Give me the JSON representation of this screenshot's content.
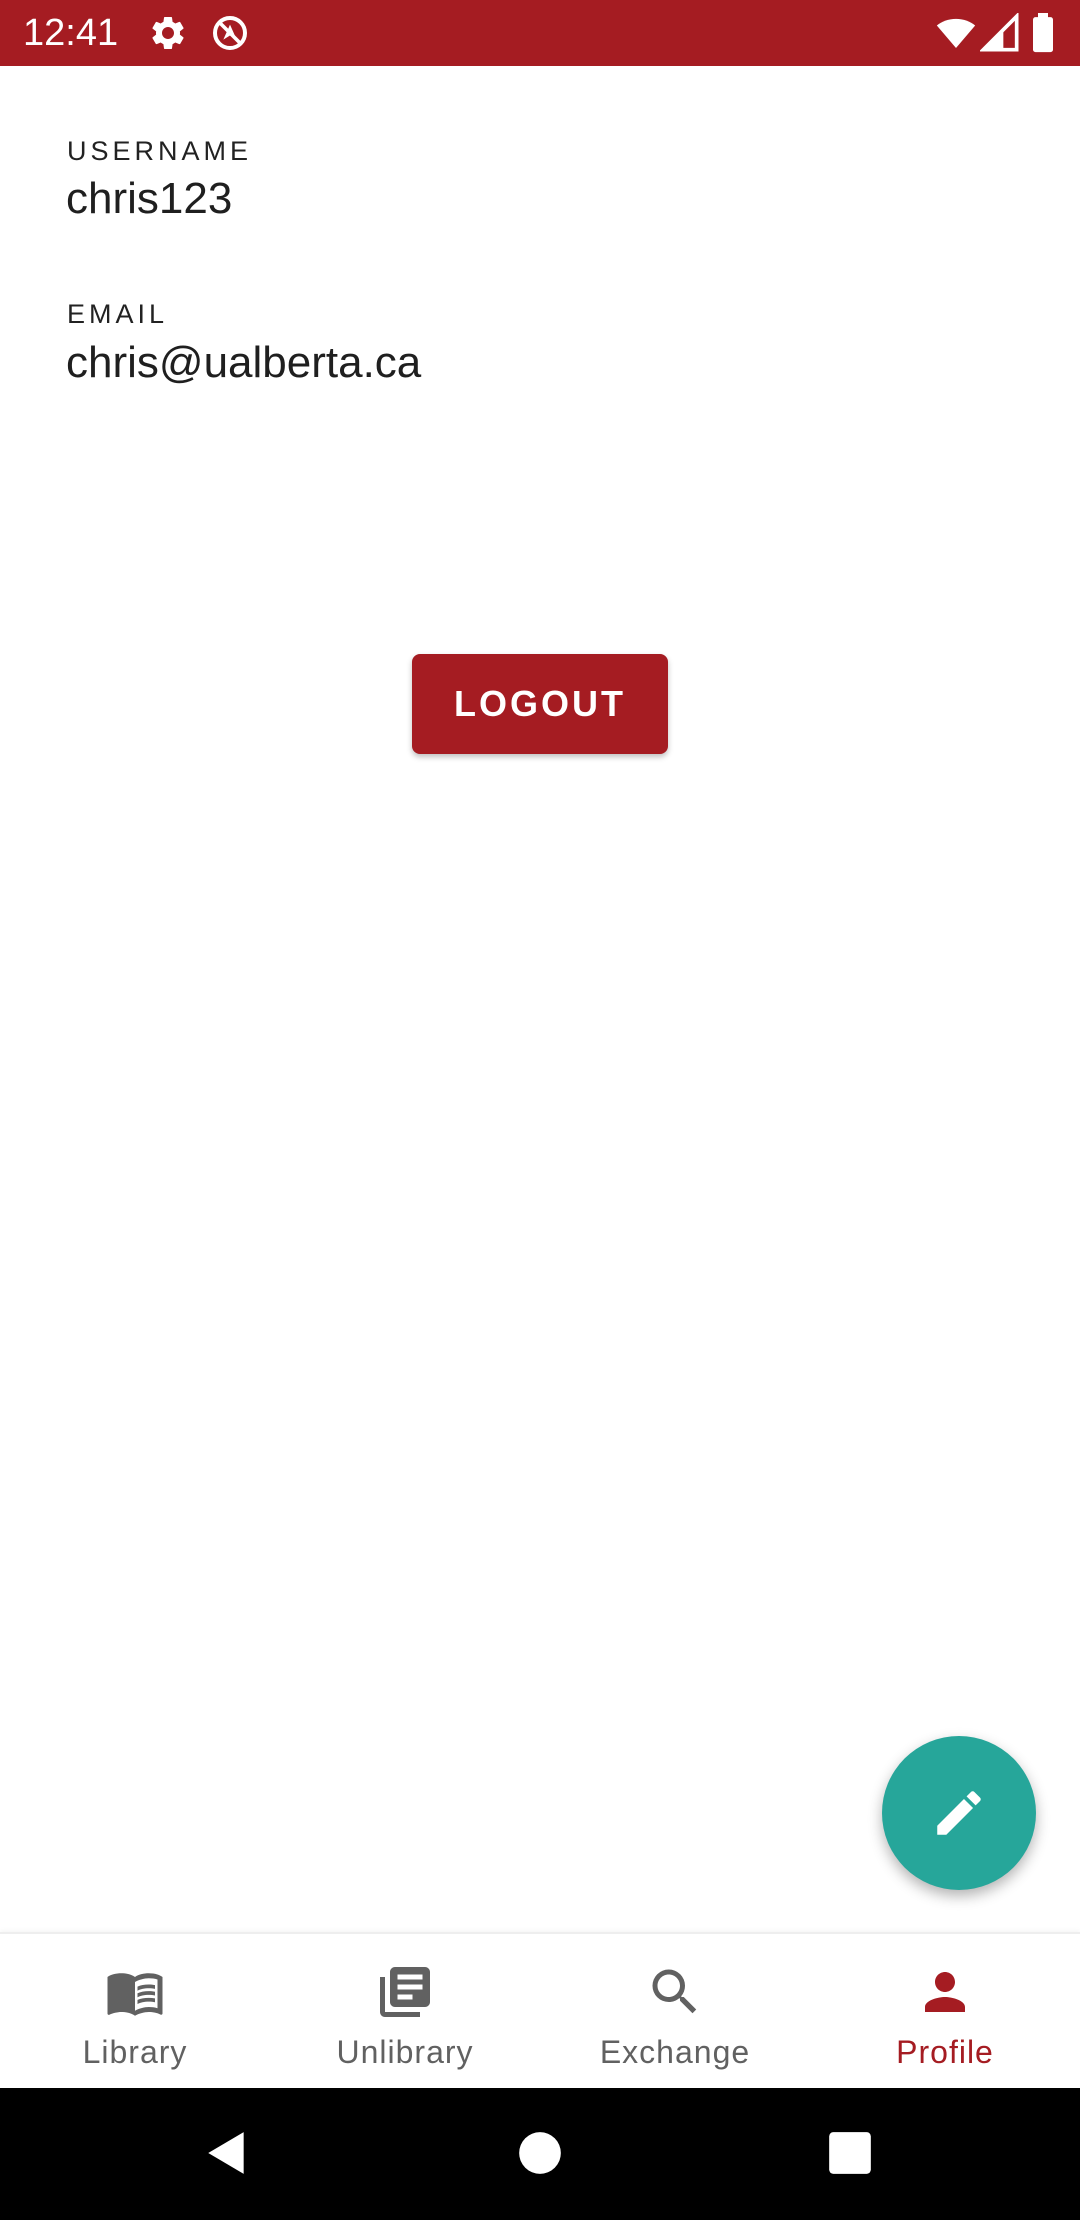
{
  "status_bar": {
    "time": "12:41",
    "background": "#a51c22",
    "left_icons": [
      "settings-gear-icon",
      "location-sync-icon"
    ],
    "right_icons": [
      "wifi-icon",
      "cell-signal-icon",
      "battery-icon"
    ]
  },
  "profile": {
    "username_label": "USERNAME",
    "username_value": "chris123",
    "email_label": "EMAIL",
    "email_value": "chris@ualberta.ca",
    "logout_label": "LOGOUT"
  },
  "fab": {
    "icon": "edit-pencil-icon",
    "color": "#26a69a"
  },
  "bottom_nav": {
    "active_color": "#a51c22",
    "inactive_color": "#616161",
    "items": [
      {
        "label": "Library",
        "icon": "open-book-icon",
        "active": false
      },
      {
        "label": "Unlibrary",
        "icon": "library-books-icon",
        "active": false
      },
      {
        "label": "Exchange",
        "icon": "search-icon",
        "active": false
      },
      {
        "label": "Profile",
        "icon": "person-icon",
        "active": true
      }
    ]
  },
  "system_nav": {
    "buttons": [
      "back-icon",
      "home-icon",
      "recents-icon"
    ]
  }
}
